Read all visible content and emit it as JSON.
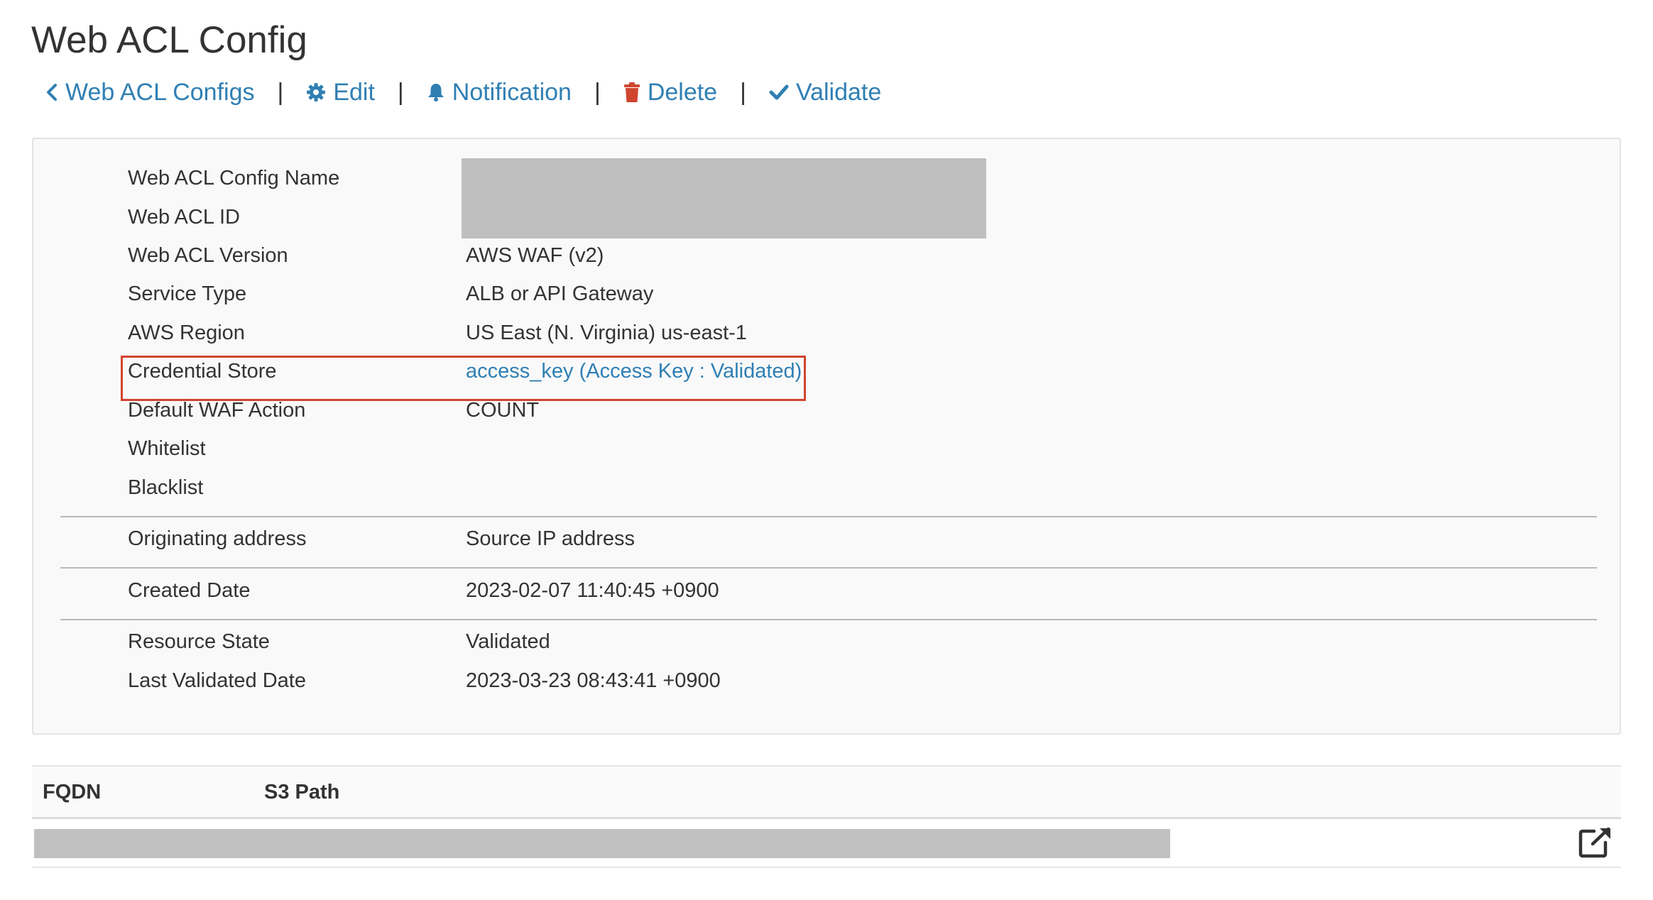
{
  "header": {
    "title": "Web ACL Config"
  },
  "actions": [
    {
      "label": "Web ACL Configs",
      "icon": "chevron-left-icon"
    },
    {
      "label": "Edit",
      "icon": "gear-icon"
    },
    {
      "label": "Notification",
      "icon": "bell-icon"
    },
    {
      "label": "Delete",
      "icon": "trash-icon"
    },
    {
      "label": "Validate",
      "icon": "check-icon"
    }
  ],
  "separator": "|",
  "details": {
    "web_acl_config_name": {
      "label": "Web ACL Config Name",
      "value": ""
    },
    "web_acl_id": {
      "label": "Web ACL ID",
      "value": ""
    },
    "web_acl_version": {
      "label": "Web ACL Version",
      "value": "AWS WAF (v2)"
    },
    "service_type": {
      "label": "Service Type",
      "value": "ALB or API Gateway"
    },
    "aws_region": {
      "label": "AWS Region",
      "value": "US East (N. Virginia) us-east-1"
    },
    "credential_store": {
      "label": "Credential Store",
      "value": "access_key (Access Key : Validated)"
    },
    "default_waf_action": {
      "label": "Default WAF Action",
      "value": "COUNT"
    },
    "whitelist": {
      "label": "Whitelist",
      "value": ""
    },
    "blacklist": {
      "label": "Blacklist",
      "value": ""
    },
    "originating_address": {
      "label": "Originating address",
      "value": "Source IP address"
    },
    "created_date": {
      "label": "Created Date",
      "value": "2023-02-07 11:40:45 +0900"
    },
    "resource_state": {
      "label": "Resource State",
      "value": "Validated"
    },
    "last_validated_date": {
      "label": "Last Validated Date",
      "value": "2023-03-23 08:43:41 +0900"
    }
  },
  "table": {
    "columns": [
      "FQDN",
      "S3 Path"
    ],
    "rows": [
      {
        "fqdn": "",
        "s3_path": "",
        "action_icon": "external-link-icon"
      }
    ]
  },
  "colors": {
    "link": "#2f7fb3",
    "delete_icon": "#d0452f",
    "highlight_border": "#d0452f",
    "panel_background": "#f9f9f9",
    "redaction": "#bfbfbf"
  }
}
